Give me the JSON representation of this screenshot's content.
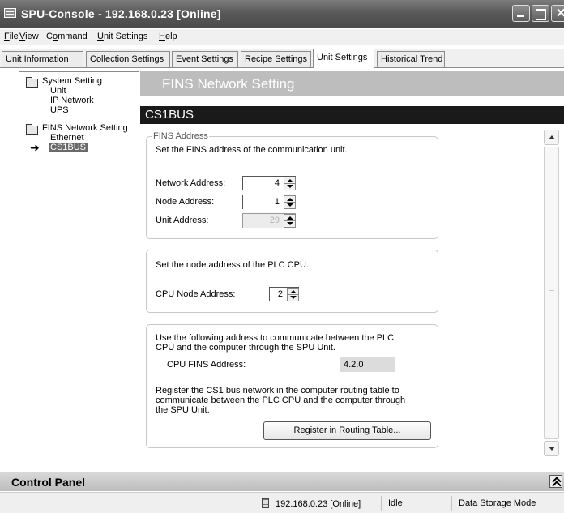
{
  "window": {
    "title": "SPU-Console - 192.168.0.23 [Online]"
  },
  "menu": [
    {
      "label": "File",
      "mnemonic": "F",
      "rest": "ile"
    },
    {
      "label": "View",
      "mnemonic": "V",
      "rest": "iew"
    },
    {
      "label": "Command",
      "pre": "C",
      "mnemonic": "o",
      "rest": "mmand"
    },
    {
      "label": "Unit Settings",
      "mnemonic": "U",
      "rest": "nit Settings"
    },
    {
      "label": "Help",
      "mnemonic": "H",
      "rest": "elp"
    }
  ],
  "tabs": [
    {
      "label": "Unit Information"
    },
    {
      "label": "Collection Settings"
    },
    {
      "label": "Event Settings"
    },
    {
      "label": "Recipe Settings"
    },
    {
      "label": "Unit Settings",
      "active": true
    },
    {
      "label": "Historical Trend"
    }
  ],
  "tree": {
    "system_setting": "System Setting",
    "unit": "Unit",
    "ip_network": "IP Network",
    "ups": "UPS",
    "fins_network_setting": "FINS Network Setting",
    "ethernet": "Ethernet",
    "cs1bus": "CS1BUS"
  },
  "content": {
    "section_title": "FINS Network Setting",
    "subsection_title": "CS1BUS",
    "fins_address": {
      "legend": "FINS Address",
      "description": "Set the FINS address of the communication unit.",
      "network_label": "Network Address:",
      "network_value": "4",
      "node_label": "Node Address:",
      "node_value": "1",
      "unit_label": "Unit Address:",
      "unit_value": "29"
    },
    "plc": {
      "description": "Set the node address of the PLC CPU.",
      "cpu_node_label": "CPU Node Address:",
      "cpu_node_value": "2"
    },
    "routing": {
      "line1": "Use the following address to communicate between the PLC",
      "line2": "CPU and the computer through the SPU Unit.",
      "cpu_fins_label": "CPU FINS Address:",
      "cpu_fins_value": "4.2.0",
      "reg_line1": "Register the CS1 bus network in the computer routing table to",
      "reg_line2": "communicate between the PLC CPU and the computer through",
      "reg_line3": "the SPU Unit.",
      "button_mnemonic": "R",
      "button_rest": "egister in Routing Table..."
    }
  },
  "control_panel": {
    "title": "Control Panel"
  },
  "status": {
    "connection": "192.168.0.23 [Online]",
    "state": "Idle",
    "mode": "Data Storage Mode"
  }
}
